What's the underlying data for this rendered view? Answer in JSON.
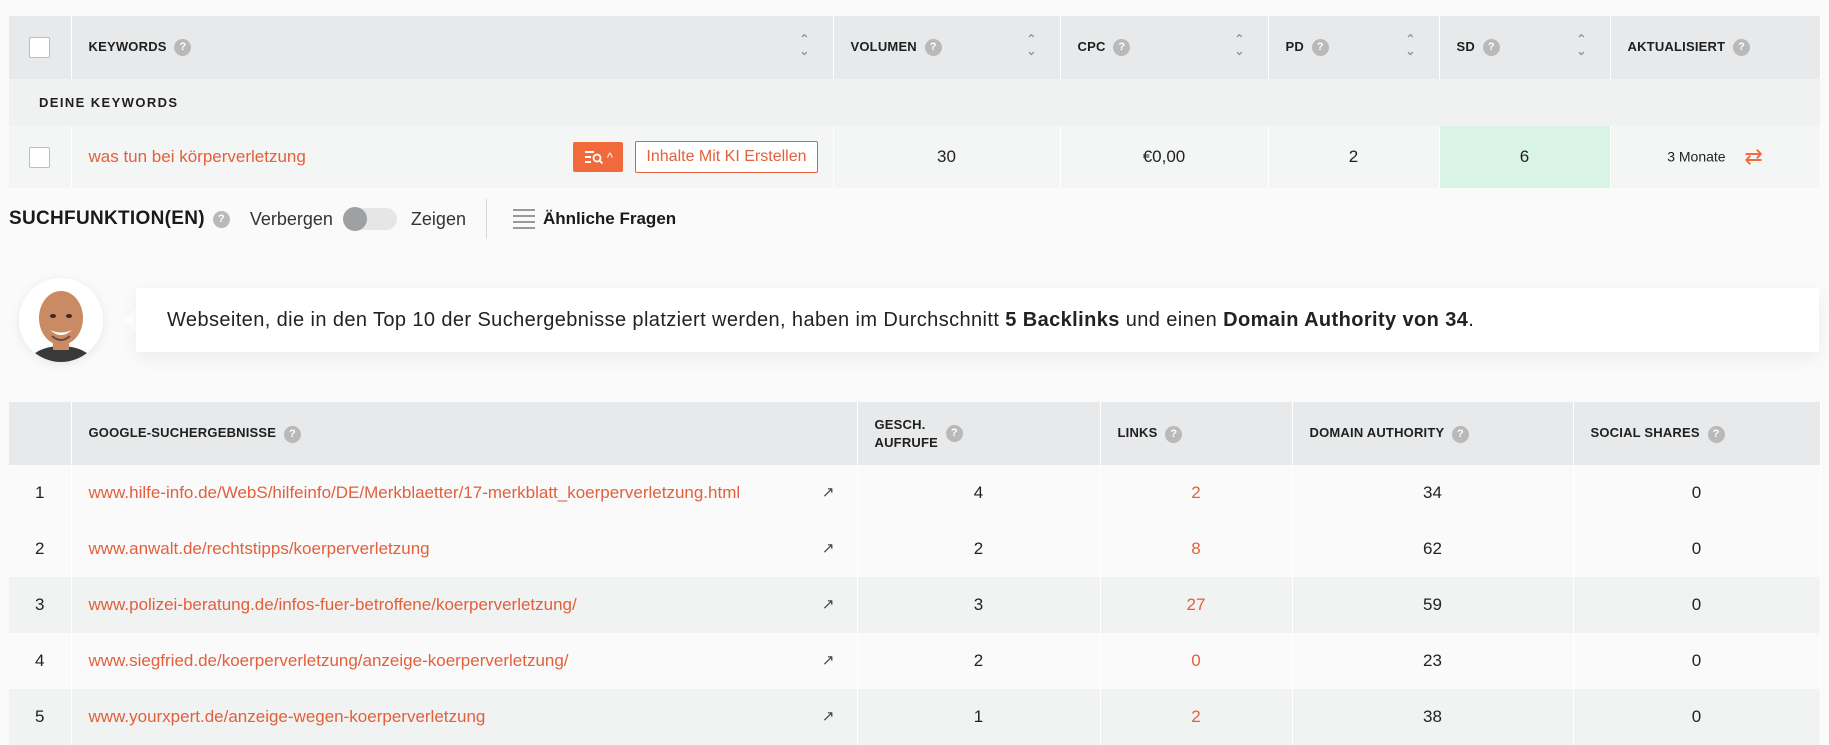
{
  "keyword_table": {
    "headers": {
      "keywords": "KEYWORDS",
      "volumen": "VOLUMEN",
      "cpc": "CPC",
      "pd": "PD",
      "sd": "SD",
      "aktualisiert": "AKTUALISIERT"
    },
    "section_label": "DEINE KEYWORDS",
    "row": {
      "keyword": "was tun bei körperverletzung",
      "ai_button": "Inhalte Mit KI Erstellen",
      "volumen": "30",
      "cpc": "€0,00",
      "pd": "2",
      "sd": "6",
      "aktualisiert": "3 Monate"
    },
    "colors": {
      "accent": "#e2603b",
      "sd_bg": "#d9f3e6"
    }
  },
  "search_features": {
    "title": "SUCHFUNKTION(EN)",
    "hide_label": "Verbergen",
    "show_label": "Zeigen",
    "questions_label": "Ähnliche Fragen"
  },
  "insight": {
    "text_before": "Webseiten, die in den Top 10 der Suchergebnisse platziert werden, haben im Durchschnitt ",
    "bold1": "5 Backlinks",
    "text_middle": " und einen ",
    "bold2": "Domain Authority von 34",
    "text_after": "."
  },
  "results_table": {
    "headers": {
      "results": "GOOGLE-SUCHERGEBNISSE",
      "visits_line1": "GESCH.",
      "visits_line2": "AUFRUFE",
      "links": "LINKS",
      "domain_authority": "DOMAIN AUTHORITY",
      "social_shares": "SOCIAL SHARES"
    },
    "rows": [
      {
        "rank": "1",
        "url": "www.hilfe-info.de/WebS/hilfeinfo/DE/Merkblaetter/17-merkblatt_koerperverletzung.html",
        "visits": "4",
        "links": "2",
        "da": "34",
        "shares": "0"
      },
      {
        "rank": "2",
        "url": "www.anwalt.de/rechtstipps/koerperverletzung",
        "visits": "2",
        "links": "8",
        "da": "62",
        "shares": "0"
      },
      {
        "rank": "3",
        "url": "www.polizei-beratung.de/infos-fuer-betroffene/koerperverletzung/",
        "visits": "3",
        "links": "27",
        "da": "59",
        "shares": "0"
      },
      {
        "rank": "4",
        "url": "www.siegfried.de/koerperverletzung/anzeige-koerperverletzung/",
        "visits": "2",
        "links": "0",
        "da": "23",
        "shares": "0"
      },
      {
        "rank": "5",
        "url": "www.yourxpert.de/anzeige-wegen-koerperverletzung",
        "visits": "1",
        "links": "2",
        "da": "38",
        "shares": "0"
      }
    ]
  },
  "icons": {
    "help": "?",
    "sort_up": "⌃",
    "sort_down": "⌄",
    "refresh": "⇄",
    "external": "↗",
    "chevron_up": "^"
  }
}
